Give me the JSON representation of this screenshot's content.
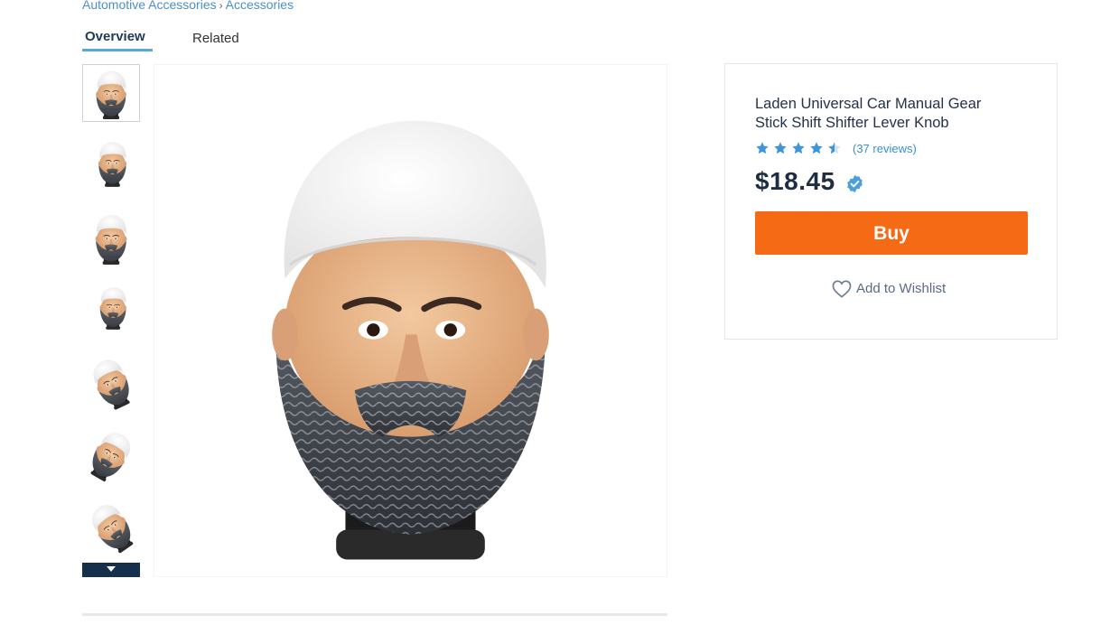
{
  "breadcrumb": {
    "items": [
      "Automotive Accessories",
      "Accessories"
    ],
    "separator": "›"
  },
  "tabs": [
    {
      "label": "Overview",
      "active": true
    },
    {
      "label": "Related",
      "active": false
    }
  ],
  "gallery": {
    "thumbnail_count": 7,
    "selected_index": 0,
    "more_icon": "chevron-down-icon",
    "main_image_alt": "gear shift knob head figure"
  },
  "product": {
    "title": "Laden Universal Car Manual Gear Stick Shift Shifter Lever Knob",
    "rating": 4.5,
    "rating_max": 5,
    "reviews_label": "(37 reviews)",
    "price": "$18.45",
    "verified_icon": "verified-check-icon",
    "buy_label": "Buy",
    "wishlist_label": "Add to Wishlist",
    "wishlist_icon": "heart-icon"
  },
  "colors": {
    "accent_orange": "#f56a14",
    "star_blue": "#3f95d6",
    "link_blue": "#3a8fcf",
    "dark_navy": "#14304a"
  }
}
